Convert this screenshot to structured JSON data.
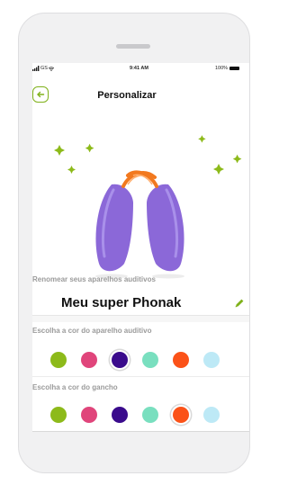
{
  "status_bar": {
    "carrier": "GS",
    "time": "9:41 AM",
    "battery": "100%"
  },
  "header": {
    "title": "Personalizar",
    "back_icon": "arrow-left-circle-icon"
  },
  "rename": {
    "label": "Renomear seus aparelhos auditivos",
    "value": "Meu super Phonak",
    "edit_icon": "pencil-icon"
  },
  "device_color": {
    "label": "Escolha a cor do aparelho auditivo",
    "swatches": [
      "#8dba1a",
      "#e0457b",
      "#3a0b8c",
      "#79dfbf",
      "#fb5218",
      "#bde9f6"
    ],
    "selected_index": 2
  },
  "hook_color": {
    "label": "Escolha a cor do gancho",
    "swatches": [
      "#8dba1a",
      "#e0457b",
      "#3a0b8c",
      "#79dfbf",
      "#fb5218",
      "#bde9f6"
    ],
    "selected_index": 4
  },
  "colors": {
    "accent": "#7fb11a",
    "device": "#8b68d8",
    "hook": "#f2791f"
  }
}
